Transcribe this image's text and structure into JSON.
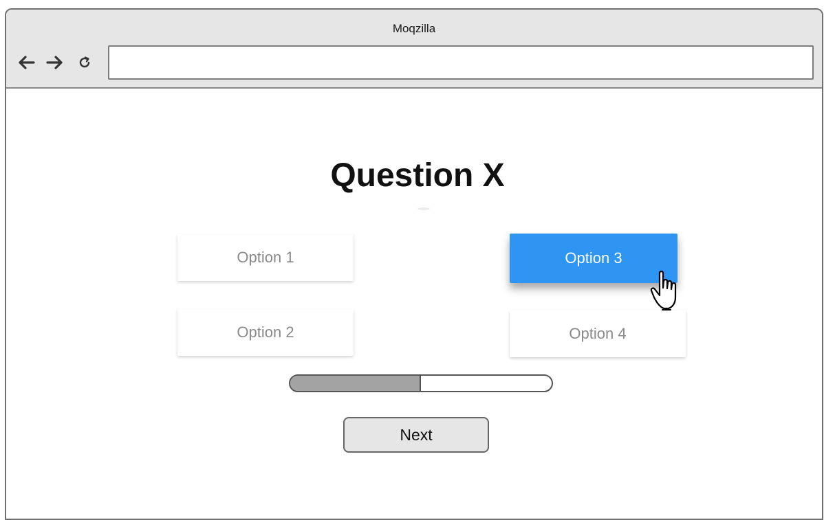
{
  "window": {
    "title": "Moqzilla"
  },
  "toolbar": {
    "back_icon": "arrow-left-icon",
    "forward_icon": "arrow-right-icon",
    "reload_icon": "reload-icon",
    "address_value": ""
  },
  "quiz": {
    "title": "Question X",
    "options": [
      {
        "label": "Option 1",
        "selected": false
      },
      {
        "label": "Option 2",
        "selected": false
      },
      {
        "label": "Option 3",
        "selected": true
      },
      {
        "label": "Option 4",
        "selected": false
      }
    ],
    "progress": 0.5,
    "next_label": "Next"
  },
  "colors": {
    "selected_option": "#2f95f2",
    "progress_fill": "#a3a3a3",
    "chrome_background": "#e6e6e6"
  }
}
